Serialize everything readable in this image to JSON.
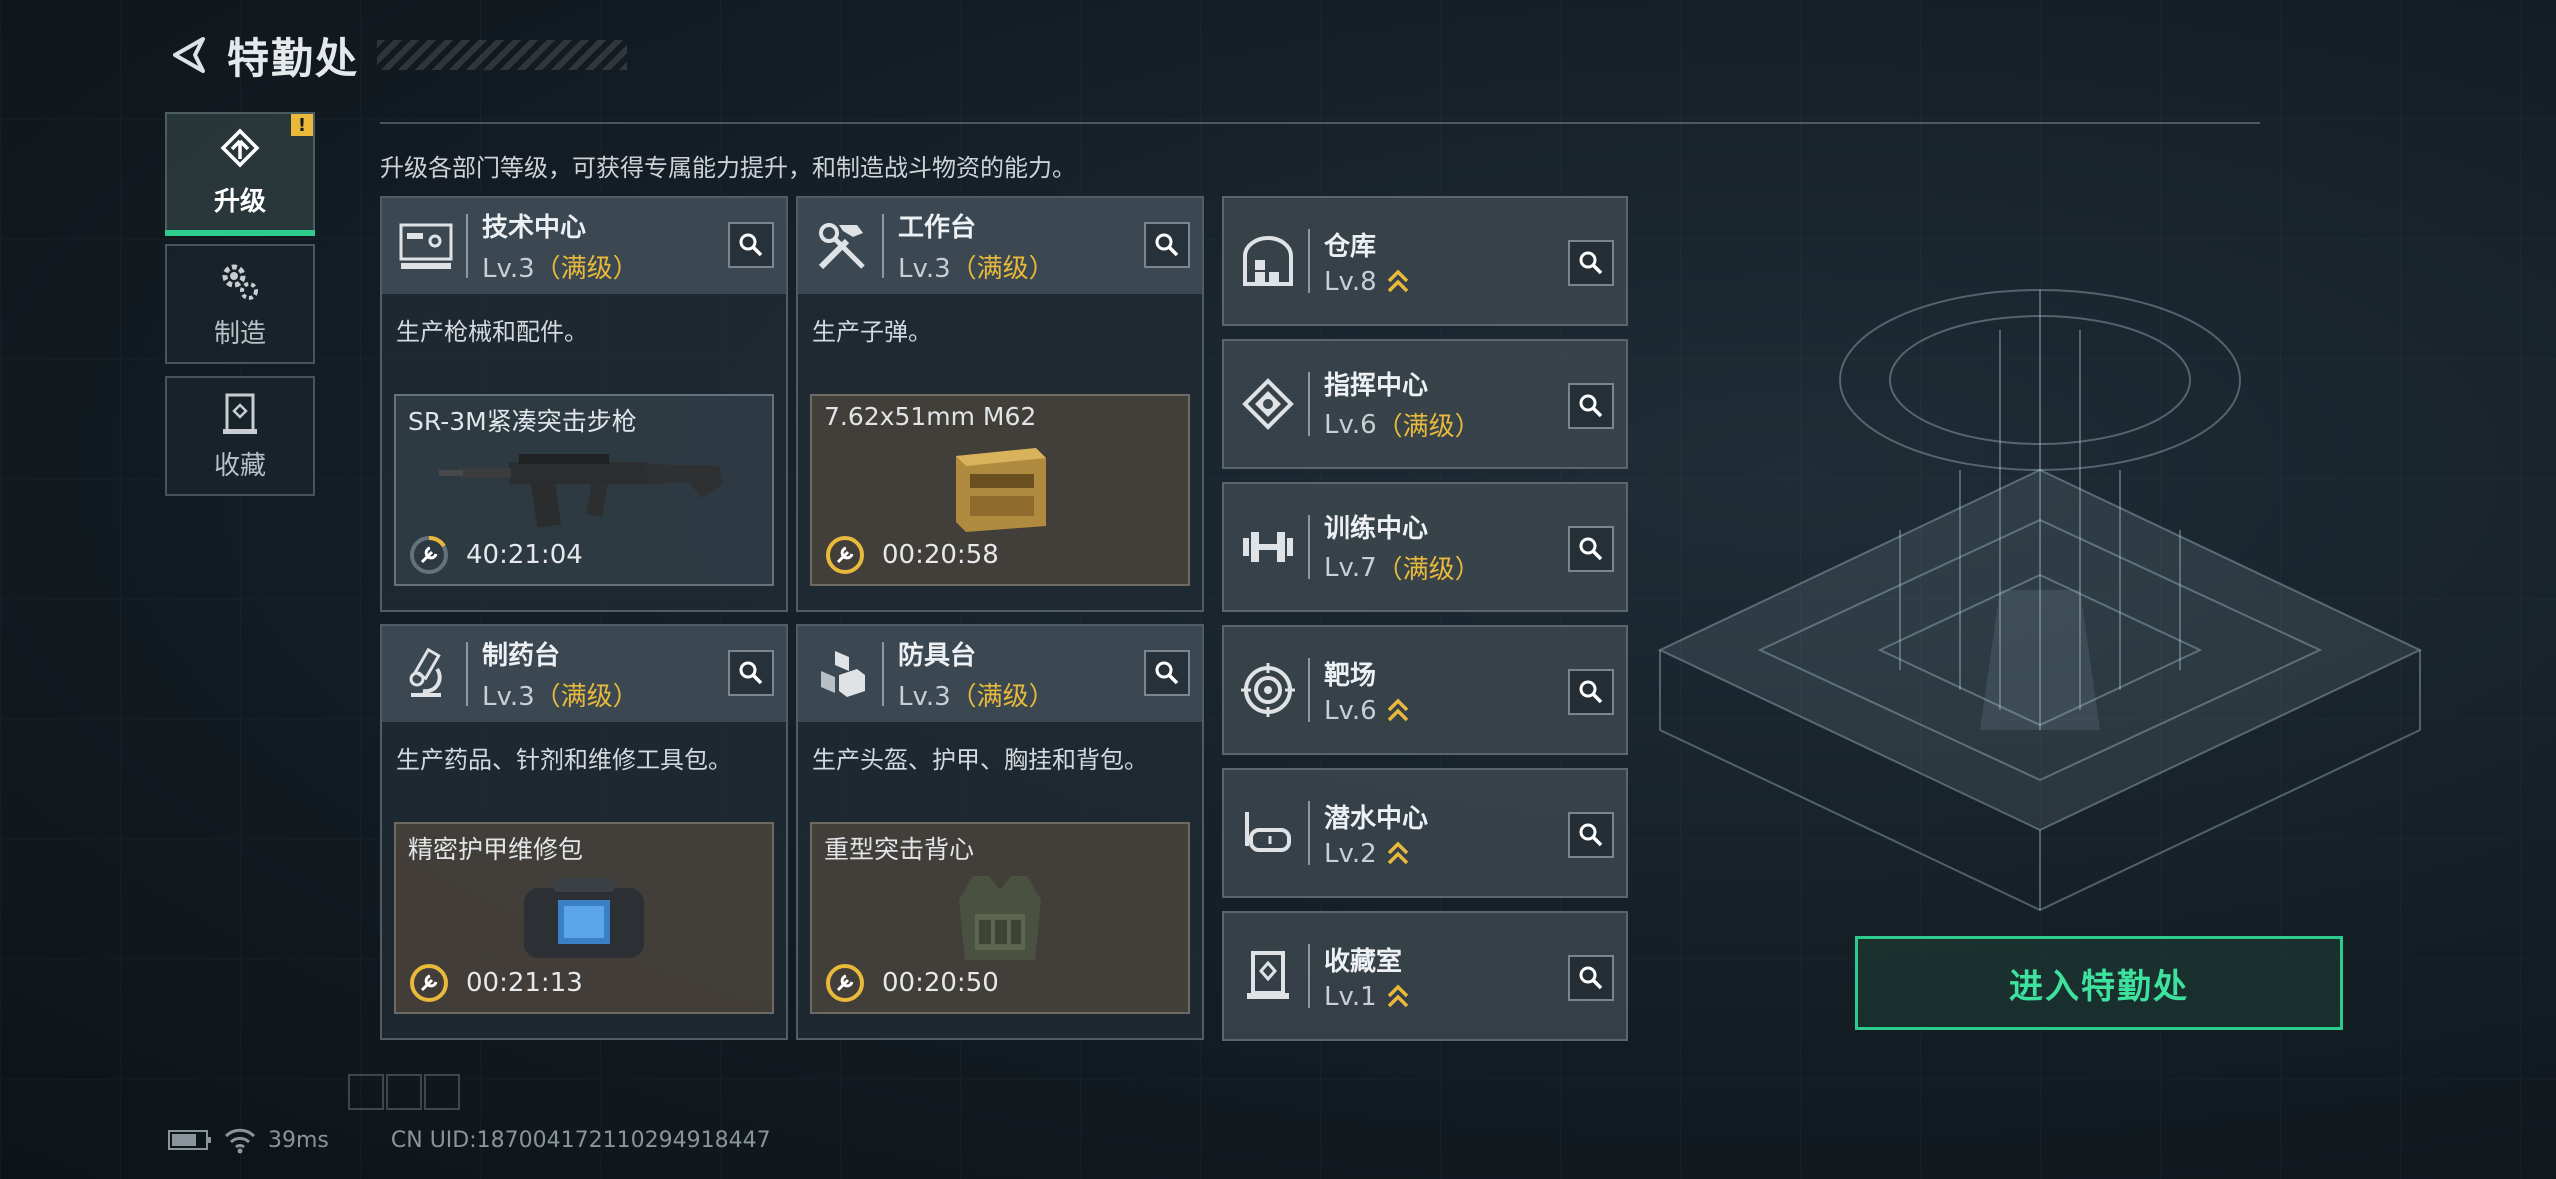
{
  "header": {
    "title": "特勤处",
    "back_icon": "back-arrow-icon"
  },
  "tabs": [
    {
      "label": "升级",
      "icon": "upgrade-icon",
      "active": true,
      "alert": "!"
    },
    {
      "label": "制造",
      "icon": "gears-icon",
      "active": false
    },
    {
      "label": "收藏",
      "icon": "collection-icon",
      "active": false
    }
  ],
  "description": "升级各部门等级，可获得专属能力提升，和制造战斗物资的能力。",
  "workshops": [
    {
      "name": "技术中心",
      "level": "Lv.3",
      "maxed": "（满级）",
      "desc": "生产枪械和配件。",
      "product": "SR-3M紧凑突击步枪",
      "timer": "40:21:04",
      "icon": "computer-icon"
    },
    {
      "name": "工作台",
      "level": "Lv.3",
      "maxed": "（满级）",
      "desc": "生产子弹。",
      "product": "7.62x51mm M62",
      "timer": "00:20:58",
      "icon": "tools-icon"
    },
    {
      "name": "制药台",
      "level": "Lv.3",
      "maxed": "（满级）",
      "desc": "生产药品、针剂和维修工具包。",
      "product": "精密护甲维修包",
      "timer": "00:21:13",
      "icon": "microscope-icon"
    },
    {
      "name": "防具台",
      "level": "Lv.3",
      "maxed": "（满级）",
      "desc": "生产头盔、护甲、胸挂和背包。",
      "product": "重型突击背心",
      "timer": "00:20:50",
      "icon": "armor-blocks-icon"
    }
  ],
  "facilities": [
    {
      "name": "仓库",
      "level": "Lv.8",
      "maxed": "",
      "upgradeable": true,
      "icon": "warehouse-icon"
    },
    {
      "name": "指挥中心",
      "level": "Lv.6",
      "maxed": "（满级）",
      "upgradeable": false,
      "icon": "command-icon"
    },
    {
      "name": "训练中心",
      "level": "Lv.7",
      "maxed": "（满级）",
      "upgradeable": false,
      "icon": "dumbbell-icon"
    },
    {
      "name": "靶场",
      "level": "Lv.6",
      "maxed": "",
      "upgradeable": true,
      "icon": "target-icon"
    },
    {
      "name": "潜水中心",
      "level": "Lv.2",
      "maxed": "",
      "upgradeable": true,
      "icon": "diving-mask-icon"
    },
    {
      "name": "收藏室",
      "level": "Lv.1",
      "maxed": "",
      "upgradeable": true,
      "icon": "collection-room-icon"
    }
  ],
  "enter_button": "进入特勤处",
  "footer": {
    "ping": "39ms",
    "uid": "CN UID:187004172110294918447"
  },
  "colors": {
    "accent_green": "#2ecc8c",
    "maxed_yellow": "#e8b93a"
  }
}
